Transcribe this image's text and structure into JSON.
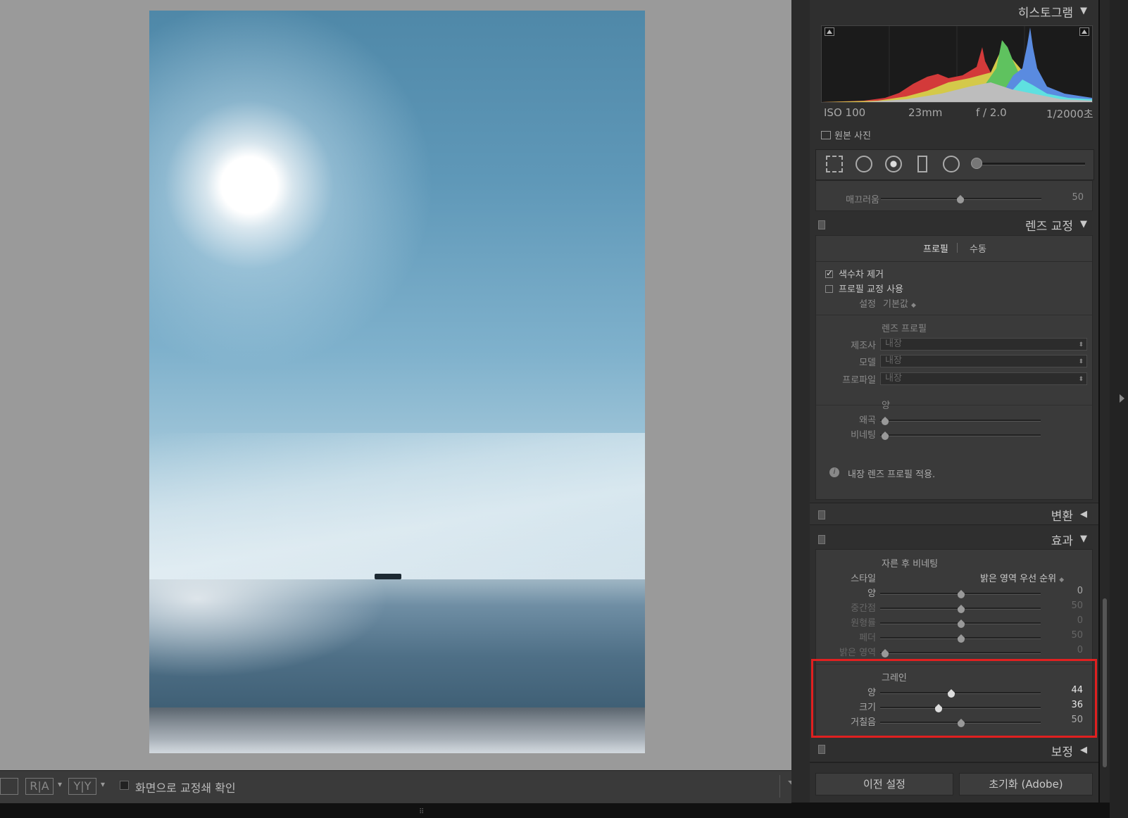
{
  "histogram": {
    "title": "히스토그램",
    "exif": {
      "iso": "ISO 100",
      "focal": "23mm",
      "aperture": "f / 2.0",
      "shutter": "1/2000초"
    },
    "original_label": "원본 사진"
  },
  "partial_row": {
    "label": "매끄러움",
    "value": "50"
  },
  "lens": {
    "title": "렌즈 교정",
    "tabs": {
      "profile": "프로필",
      "manual": "수동"
    },
    "remove_ca": "색수차 제거",
    "enable_profile": "프로필 교정 사용",
    "setup_label": "설정",
    "setup_value": "기본값",
    "lens_profile_heading": "렌즈 프로필",
    "make_label": "제조사",
    "make_value": "내장",
    "model_label": "모델",
    "model_value": "내장",
    "profile_label": "프로파일",
    "profile_value": "내장",
    "amount_heading": "양",
    "distortion_label": "왜곡",
    "vignetting_label": "비네팅",
    "info": "내장 렌즈 프로필 적용."
  },
  "transform": {
    "title": "변환"
  },
  "effects": {
    "title": "효과",
    "vignette_heading": "자른 후 비네팅",
    "style_label": "스타일",
    "style_value": "밝은 영역 우선 순위",
    "amount_label": "양",
    "amount_value": "0",
    "midpoint_label": "중간점",
    "midpoint_value": "50",
    "roundness_label": "원형률",
    "roundness_value": "0",
    "feather_label": "페더",
    "feather_value": "50",
    "highlights_label": "밝은 영역",
    "highlights_value": "0",
    "grain_heading": "그레인",
    "grain_amount_label": "양",
    "grain_amount_value": "44",
    "grain_size_label": "크기",
    "grain_size_value": "36",
    "grain_rough_label": "거칠음",
    "grain_rough_value": "50"
  },
  "calibration": {
    "title": "보정"
  },
  "buttons": {
    "previous": "이전 설정",
    "reset": "초기화 (Adobe)"
  },
  "toolbar": {
    "ra_label": "R|A",
    "yy_label": "Y|Y",
    "softproof_label": "화면으로 교정쇄 확인"
  },
  "colors": {
    "highlight": "#e02020",
    "panel_bg": "#3a3a3a",
    "canvas_bg": "#9a9a9a"
  }
}
